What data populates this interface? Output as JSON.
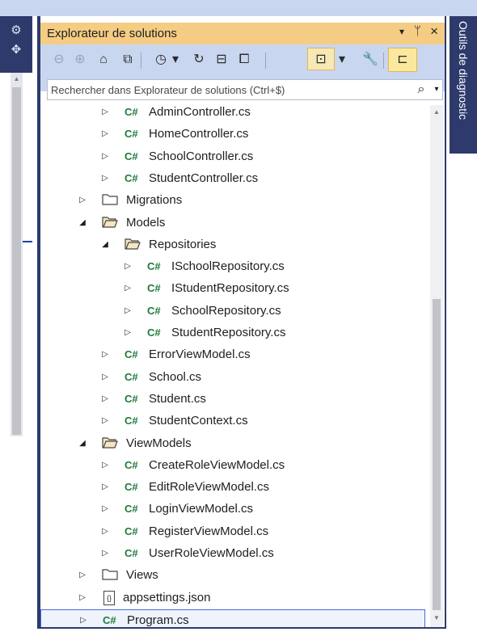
{
  "left_strip": {
    "gear_icon": "⚙",
    "move_icon": "✥"
  },
  "right_strip": {
    "tab_label": "Outils de diagnostic"
  },
  "panel": {
    "title": "Explorateur de solutions",
    "title_controls": {
      "dropdown": "▾",
      "pin": "ᛘ",
      "close": "×"
    }
  },
  "toolbar": {
    "items": [
      {
        "name": "back-icon",
        "glyph": "⊖"
      },
      {
        "name": "forward-icon",
        "glyph": "⊕"
      },
      {
        "name": "home-icon",
        "glyph": "⌂"
      },
      {
        "name": "vs-icon",
        "glyph": "⧉"
      },
      {
        "name": "history-icon",
        "glyph": "◷"
      },
      {
        "name": "history-dropdown-icon",
        "glyph": "▾"
      },
      {
        "name": "refresh-icon",
        "glyph": "↻"
      },
      {
        "name": "collapse-icon",
        "glyph": "⊟"
      },
      {
        "name": "copy-icon",
        "glyph": "⧠"
      },
      {
        "name": "tree-view-icon",
        "glyph": "⊡"
      },
      {
        "name": "tree-dropdown-icon",
        "glyph": "▾"
      },
      {
        "name": "wrench-icon",
        "glyph": "🔧"
      },
      {
        "name": "preview-icon",
        "glyph": "⊏"
      }
    ]
  },
  "search": {
    "placeholder": "Rechercher dans Explorateur de solutions (Ctrl+$)",
    "icon": "⌕",
    "dropdown": "▾"
  },
  "tree": {
    "rows": [
      {
        "label": "AdminController.cs",
        "kind": "cs",
        "level": 3,
        "expander": "▷"
      },
      {
        "label": "HomeController.cs",
        "kind": "cs",
        "level": 3,
        "expander": "▷"
      },
      {
        "label": "SchoolController.cs",
        "kind": "cs",
        "level": 3,
        "expander": "▷"
      },
      {
        "label": "StudentController.cs",
        "kind": "cs",
        "level": 3,
        "expander": "▷"
      },
      {
        "label": "Migrations",
        "kind": "folder",
        "level": 2,
        "expander": "▷"
      },
      {
        "label": "Models",
        "kind": "folder-open",
        "level": 2,
        "expander": "◢"
      },
      {
        "label": "Repositories",
        "kind": "folder-open",
        "level": 3,
        "expander": "◢"
      },
      {
        "label": "ISchoolRepository.cs",
        "kind": "cs",
        "level": 4,
        "expander": "▷"
      },
      {
        "label": "IStudentRepository.cs",
        "kind": "cs",
        "level": 4,
        "expander": "▷"
      },
      {
        "label": "SchoolRepository.cs",
        "kind": "cs",
        "level": 4,
        "expander": "▷"
      },
      {
        "label": "StudentRepository.cs",
        "kind": "cs",
        "level": 4,
        "expander": "▷"
      },
      {
        "label": "ErrorViewModel.cs",
        "kind": "cs",
        "level": 3,
        "expander": "▷"
      },
      {
        "label": "School.cs",
        "kind": "cs",
        "level": 3,
        "expander": "▷"
      },
      {
        "label": "Student.cs",
        "kind": "cs",
        "level": 3,
        "expander": "▷"
      },
      {
        "label": "StudentContext.cs",
        "kind": "cs",
        "level": 3,
        "expander": "▷"
      },
      {
        "label": "ViewModels",
        "kind": "folder-open",
        "level": 2,
        "expander": "◢"
      },
      {
        "label": "CreateRoleViewModel.cs",
        "kind": "cs",
        "level": 3,
        "expander": "▷"
      },
      {
        "label": "EditRoleViewModel.cs",
        "kind": "cs",
        "level": 3,
        "expander": "▷"
      },
      {
        "label": "LoginViewModel.cs",
        "kind": "cs",
        "level": 3,
        "expander": "▷"
      },
      {
        "label": "RegisterViewModel.cs",
        "kind": "cs",
        "level": 3,
        "expander": "▷"
      },
      {
        "label": "UserRoleViewModel.cs",
        "kind": "cs",
        "level": 3,
        "expander": "▷"
      },
      {
        "label": "Views",
        "kind": "folder",
        "level": 2,
        "expander": "▷"
      },
      {
        "label": "appsettings.json",
        "kind": "json",
        "level": 2,
        "expander": "▷"
      },
      {
        "label": "Program.cs",
        "kind": "cs",
        "level": 2,
        "expander": "▷",
        "selected": true
      }
    ],
    "cs_badge": "C#",
    "json_badge": "{}"
  },
  "scrollbar": {
    "up": "▲",
    "down": "▼"
  },
  "colors": {
    "title_bar": "#f5cc84",
    "toolbar": "#c9d6ef",
    "frame": "#2d3a6b",
    "cs_icon": "#1f7a3a",
    "folder": "#dcb67a",
    "selection_border": "#4a6bd5"
  }
}
